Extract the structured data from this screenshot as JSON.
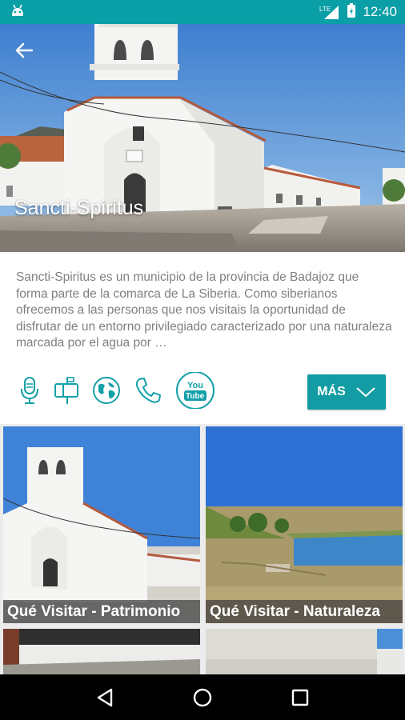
{
  "status_bar": {
    "app_icon": "android-icon",
    "network": "LTE",
    "time": "12:40"
  },
  "hero": {
    "title": "Sancti-Spiritus",
    "back_icon": "arrow-back-icon"
  },
  "description": {
    "text": "Sancti-Spiritus es un municipio de la provincia de Badajoz que forma parte de la comarca de La Siberia. Como siberianos ofrecemos a las personas que nos visitais la oportunidad de disfrutar de un entorno privilegiado caracterizado por una naturaleza marcada por el agua por …"
  },
  "actions": {
    "icons": [
      "microphone-icon",
      "mailbox-icon",
      "globe-icon",
      "phone-icon",
      "youtube-icon"
    ],
    "youtube_text_top": "You",
    "youtube_text_bottom": "Tube",
    "more_label": "MÁS"
  },
  "grid": {
    "tiles": [
      {
        "label": "Qué Visitar - Patrimonio"
      },
      {
        "label": "Qué Visitar - Naturaleza"
      },
      {
        "label": ""
      },
      {
        "label": ""
      }
    ]
  },
  "colors": {
    "accent": "#0a9ea6",
    "button": "#139ca3",
    "text_muted": "#808080"
  }
}
